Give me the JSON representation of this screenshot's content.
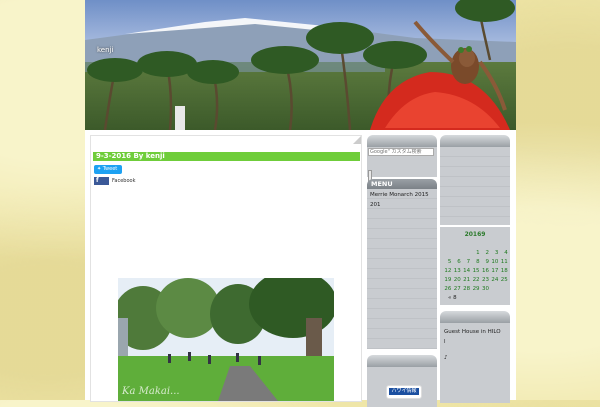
{
  "site": {
    "title": "kenji"
  },
  "post": {
    "title": "9-3-2016 By kenji",
    "tweet_label": "Tweet",
    "facebook_icon": "f",
    "facebook_label": "Facebook",
    "photo_watermark": "Ka Makai..."
  },
  "search": {
    "placeholder": "Google\" カスタム検索"
  },
  "menu": {
    "heading": "MENU",
    "items": [
      "Merrie Monarch 2015",
      "201"
    ]
  },
  "calendar": {
    "caption": "20169",
    "rows": [
      [
        "",
        "",
        "",
        "1",
        "2",
        "3",
        "4"
      ],
      [
        "5",
        "6",
        "7",
        "8",
        "9",
        "10",
        "11"
      ],
      [
        "12",
        "13",
        "14",
        "15",
        "16",
        "17",
        "18"
      ],
      [
        "19",
        "20",
        "21",
        "22",
        "23",
        "24",
        "25"
      ],
      [
        "26",
        "27",
        "28",
        "29",
        "30",
        "",
        ""
      ]
    ],
    "prev_link": "« 8"
  },
  "sidebar_right": {
    "items": [
      "Guest House in HILO",
      "l",
      "♪"
    ]
  },
  "badge": {
    "hawaii_info": "ハワイ情報"
  },
  "colors": {
    "accent_green": "#6fcd3a",
    "panel_gray": "#c9ccd0",
    "calendar_green": "#1f7a1f"
  }
}
